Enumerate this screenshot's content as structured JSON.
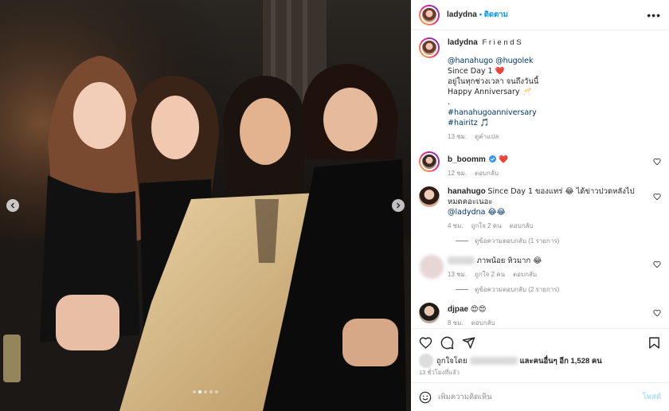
{
  "header": {
    "username": "ladydna",
    "follow_label": "• ติดตาม",
    "more_label": "•••"
  },
  "caption": {
    "username": "ladydna",
    "title": "F r i e n d S",
    "lines": [
      "@hanahugo @hugolek",
      "Since Day 1 ❤️",
      "อยู่ในทุกช่วงเวลา จนถึงวันนี้",
      "Happy Anniversary 🥂",
      ".",
      "#hanahugoanniversary",
      "#hairitz 🎵"
    ],
    "time": "13 ชม.",
    "translate": "ดูคำแปล"
  },
  "comments": [
    {
      "username": "b_boomm",
      "verified": true,
      "text": "❤️",
      "time": "12 ชม.",
      "likes": "",
      "reply": "ตอบกลับ",
      "view_replies": ""
    },
    {
      "username": "hanahugo",
      "verified": false,
      "text": "Since Day 1 ของแทร่ 😂 ได้ข่าวปวดหลังไปหมดคอะเนอะ",
      "text2": "@ladydna 😂😂",
      "time": "4 ชม.",
      "likes": "ถูกใจ 2 คน",
      "reply": "ตอบกลับ",
      "view_replies": "ดูข้อความตอบกลับ (1 รายการ)"
    },
    {
      "username": "",
      "verified": false,
      "text": "ภาพน้อย หิวมาก 😂",
      "time": "13 ชม.",
      "likes": "ถูกใจ 2 คน",
      "reply": "ตอบกลับ",
      "view_replies": "ดูข้อความตอบกลับ (2 รายการ)"
    },
    {
      "username": "djpae",
      "verified": false,
      "text": "😍😍",
      "time": "8 ชม.",
      "likes": "",
      "reply": "ตอบกลับ",
      "view_replies": ""
    }
  ],
  "likes": {
    "prefix": "ถูกใจโดย",
    "suffix": "และคนอื่นๆ อีก 1,528 คน"
  },
  "post_time": "13 ชั่วโมงที่แล้ว",
  "add_comment": {
    "placeholder": "เพิ่มความคิดเห็น",
    "post_label": "โพสต์"
  },
  "carousel": {
    "slide_count": 5,
    "active_index": 1
  },
  "colors": {
    "accent": "#0095f6",
    "heart": "#ed4956",
    "verified": "#3897f0"
  }
}
